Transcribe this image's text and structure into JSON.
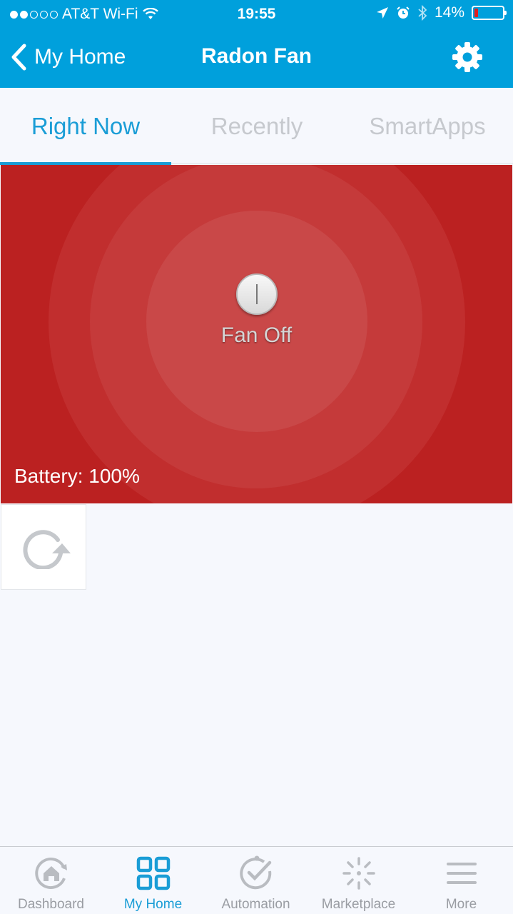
{
  "status_bar": {
    "carrier": "AT&T Wi-Fi",
    "time": "19:55",
    "battery_percent": "14%"
  },
  "nav": {
    "back_label": "My Home",
    "title": "Radon Fan"
  },
  "tabs": [
    {
      "label": "Right Now",
      "active": true
    },
    {
      "label": "Recently",
      "active": false
    },
    {
      "label": "SmartApps",
      "active": false
    }
  ],
  "device_tile": {
    "state_label": "Fan Off",
    "battery_label": "Battery: 100%",
    "background_color": "#bb2121"
  },
  "tab_bar": [
    {
      "label": "Dashboard",
      "icon": "dashboard-icon"
    },
    {
      "label": "My Home",
      "icon": "my-home-grid-icon",
      "active": true
    },
    {
      "label": "Automation",
      "icon": "automation-check-icon"
    },
    {
      "label": "Marketplace",
      "icon": "marketplace-icon"
    },
    {
      "label": "More",
      "icon": "menu-icon"
    }
  ],
  "colors": {
    "accent": "#00a0dc",
    "tab_active": "#1a9dd6",
    "inactive": "#9a9da3"
  }
}
